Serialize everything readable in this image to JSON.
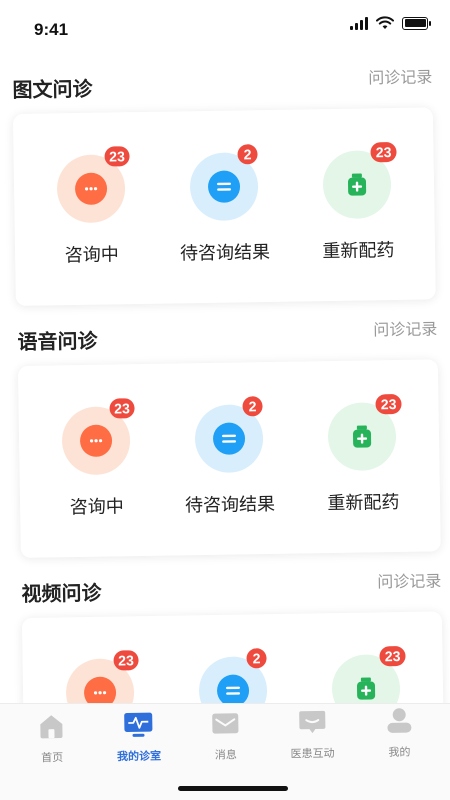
{
  "status_bar": {
    "time": "9:41"
  },
  "sections": [
    {
      "title": "图文问诊",
      "record_link": "问诊记录",
      "items": [
        {
          "label": "咨询中",
          "badge": "23",
          "icon": "chat-bubble-icon"
        },
        {
          "label": "待咨询结果",
          "badge": "2",
          "icon": "equals-icon"
        },
        {
          "label": "重新配药",
          "badge": "23",
          "icon": "medicine-bottle-icon"
        }
      ]
    },
    {
      "title": "语音问诊",
      "record_link": "问诊记录",
      "items": [
        {
          "label": "咨询中",
          "badge": "23",
          "icon": "chat-bubble-icon"
        },
        {
          "label": "待咨询结果",
          "badge": "2",
          "icon": "equals-icon"
        },
        {
          "label": "重新配药",
          "badge": "23",
          "icon": "medicine-bottle-icon"
        }
      ]
    },
    {
      "title": "视频问诊",
      "record_link": "问诊记录",
      "items": [
        {
          "badge": "23",
          "icon": "chat-bubble-icon"
        },
        {
          "badge": "2",
          "icon": "equals-icon"
        },
        {
          "badge": "23",
          "icon": "medicine-bottle-icon"
        }
      ]
    }
  ],
  "tab_bar": {
    "items": [
      {
        "label": "首页",
        "icon": "home-icon"
      },
      {
        "label": "我的诊室",
        "icon": "monitor-pulse-icon",
        "active": true
      },
      {
        "label": "消息",
        "icon": "envelope-icon"
      },
      {
        "label": "医患互动",
        "icon": "chat-box-icon"
      },
      {
        "label": "我的",
        "icon": "person-icon"
      }
    ]
  },
  "colors": {
    "chat_bg": "#fde3d6",
    "chat_fg": "#ff6d45",
    "pending_bg": "#d8eefc",
    "pending_fg": "#1f9ff5",
    "medicine_bg": "#e3f6e8",
    "medicine_fg": "#27b35a",
    "badge": "#ee4b3e",
    "active_tab": "#2f6fdb",
    "inactive_tab_icon": "#c8c8c8"
  }
}
